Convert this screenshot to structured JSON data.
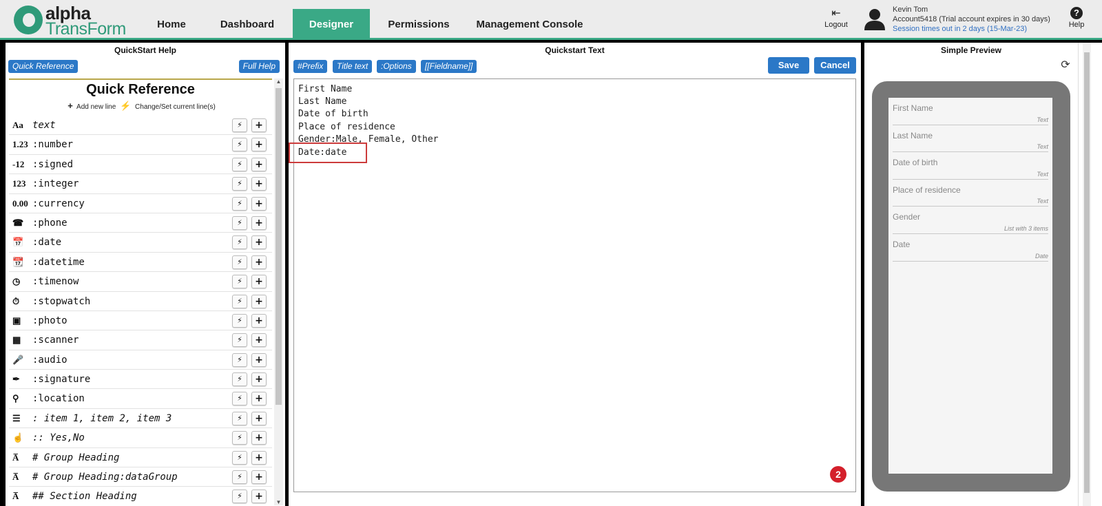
{
  "brand": {
    "word1": "alpha",
    "word2": "TransForm"
  },
  "nav": {
    "tabs": [
      {
        "label": "Home"
      },
      {
        "label": "Dashboard"
      },
      {
        "label": "Designer"
      },
      {
        "label": "Permissions"
      },
      {
        "label": "Management Console"
      }
    ],
    "active": "Designer"
  },
  "header": {
    "logout_label": "Logout",
    "user_name": "Kevin Tom",
    "account": "Account5418 (Trial account expires in 30 days)",
    "session": "Session times out in 2 days (15-Mar-23)",
    "help_label": "Help"
  },
  "quickstart_help": {
    "title": "QuickStart Help",
    "quick_reference_btn": "Quick Reference",
    "full_help_btn": "Full Help",
    "heading": "Quick Reference",
    "legend_add": "Add new line",
    "legend_change": "Change/Set current line(s)",
    "items": [
      {
        "icon": "Aa",
        "icon_name": "text-icon",
        "text": "text"
      },
      {
        "icon": "1.23",
        "icon_name": "number-icon",
        "text": ":number"
      },
      {
        "icon": "-12",
        "icon_name": "signed-icon",
        "text": ":signed"
      },
      {
        "icon": "123",
        "icon_name": "integer-icon",
        "text": ":integer"
      },
      {
        "icon": "0.00",
        "icon_name": "currency-icon",
        "text": ":currency"
      },
      {
        "icon": "☎",
        "icon_name": "phone-icon",
        "text": ":phone"
      },
      {
        "icon": "📅",
        "icon_name": "calendar-icon",
        "text": ":date"
      },
      {
        "icon": "📆",
        "icon_name": "calendar-clock-icon",
        "text": ":datetime"
      },
      {
        "icon": "◷",
        "icon_name": "clock-icon",
        "text": ":timenow"
      },
      {
        "icon": "⏱",
        "icon_name": "stopwatch-icon",
        "text": ":stopwatch"
      },
      {
        "icon": "▣",
        "icon_name": "photo-icon",
        "text": ":photo"
      },
      {
        "icon": "▦",
        "icon_name": "qr-code-icon",
        "text": ":scanner"
      },
      {
        "icon": "🎤",
        "icon_name": "microphone-icon",
        "text": ":audio"
      },
      {
        "icon": "✒",
        "icon_name": "pen-icon",
        "text": ":signature"
      },
      {
        "icon": "⚲",
        "icon_name": "location-pin-icon",
        "text": ":location"
      },
      {
        "icon": "☰",
        "icon_name": "list-icon",
        "text": ": item 1, item 2, item 3"
      },
      {
        "icon": "☝",
        "icon_name": "pointer-hand-icon",
        "text": ":: Yes,No"
      },
      {
        "icon": "A̅",
        "icon_name": "group-heading-icon",
        "text": "# Group Heading"
      },
      {
        "icon": "A̅",
        "icon_name": "group-heading-data-icon",
        "text": "# Group Heading:dataGroup"
      },
      {
        "icon": "A̅",
        "icon_name": "section-heading-icon",
        "text": "## Section Heading"
      }
    ]
  },
  "quickstart_text": {
    "title": "Quickstart Text",
    "buttons": [
      "#Prefix",
      "Title text",
      ":Options",
      "[[Fieldname]]"
    ],
    "save_label": "Save",
    "cancel_label": "Cancel",
    "lines": [
      "First Name",
      "Last Name",
      "Date of birth",
      "Place of residence",
      "Gender:Male, Female, Other",
      "Date:date"
    ],
    "step_badge": "2"
  },
  "simple_preview": {
    "title": "Simple Preview",
    "fields": [
      {
        "label": "First Name",
        "type": "Text"
      },
      {
        "label": "Last Name",
        "type": "Text"
      },
      {
        "label": "Date of birth",
        "type": "Text"
      },
      {
        "label": "Place of residence",
        "type": "Text"
      },
      {
        "label": "Gender",
        "type": "List with 3 items"
      },
      {
        "label": "Date",
        "type": "Date"
      }
    ]
  },
  "colors": {
    "accent_green": "#3aa986",
    "button_blue": "#2b78c7",
    "highlight_red": "#cc3b3b",
    "badge_red": "#d4202b"
  }
}
